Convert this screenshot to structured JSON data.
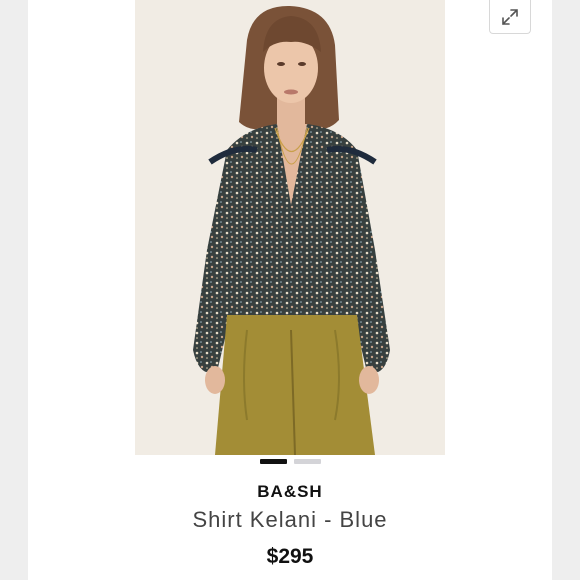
{
  "product": {
    "brand": "BA&SH",
    "title": "Shirt Kelani - Blue",
    "price": "$295",
    "image_alt": "Model wearing floral print shirt with olive trousers"
  },
  "gallery": {
    "slides": [
      {
        "active": true
      },
      {
        "active": false
      }
    ],
    "active_color": "#111111",
    "inactive_color": "#d4d4d8"
  },
  "icons": {
    "expand": "expand-arrows-icon"
  }
}
